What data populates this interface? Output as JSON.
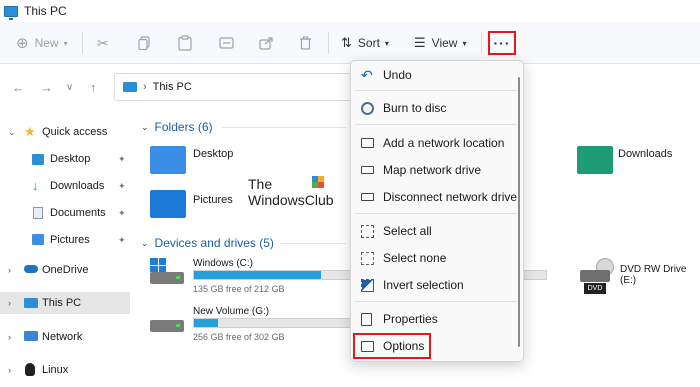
{
  "window": {
    "title": "This PC"
  },
  "toolbar": {
    "new_label": "New",
    "sort_label": "Sort",
    "view_label": "View",
    "more_label": "···"
  },
  "address": {
    "location": "This PC"
  },
  "sidebar": {
    "items": [
      {
        "label": "Quick access"
      },
      {
        "label": "Desktop"
      },
      {
        "label": "Downloads"
      },
      {
        "label": "Documents"
      },
      {
        "label": "Pictures"
      },
      {
        "label": "OneDrive"
      },
      {
        "label": "This PC"
      },
      {
        "label": "Network"
      },
      {
        "label": "Linux"
      }
    ]
  },
  "content": {
    "folders_header": "Folders (6)",
    "folders": [
      {
        "label": "Desktop"
      },
      {
        "label": "Pictures"
      },
      {
        "label": "Downloads"
      }
    ],
    "drives_header": "Devices and drives (5)",
    "drives": [
      {
        "label": "Windows (C:)",
        "free": "135 GB free of 212 GB",
        "used_fraction": 0.36
      },
      {
        "label": "New Volume (G:)",
        "free": "256 GB free of 302 GB",
        "used_fraction": 0.15
      },
      {
        "label": "DVD RW Drive (E:)",
        "badge": "DVD"
      }
    ],
    "watermark_line1": "The",
    "watermark_line2": "WindowsClub"
  },
  "menu": {
    "items": [
      {
        "label": "Undo"
      },
      {
        "label": "Burn to disc"
      },
      {
        "label": "Add a network location"
      },
      {
        "label": "Map network drive"
      },
      {
        "label": "Disconnect network drive"
      },
      {
        "label": "Select all"
      },
      {
        "label": "Select none"
      },
      {
        "label": "Invert selection"
      },
      {
        "label": "Properties"
      },
      {
        "label": "Options"
      }
    ]
  },
  "colors": {
    "accent": "#1a5fa8",
    "highlight_red": "#e0191b",
    "drive_fill": "#26a0da"
  }
}
